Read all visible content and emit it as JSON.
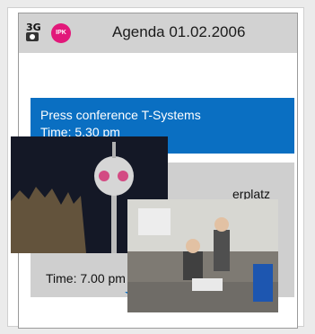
{
  "header": {
    "title": "Agenda 01.02.2006",
    "icons": [
      "3g-icon",
      "ipk-logo"
    ],
    "icon_text": {
      "g3": "3G",
      "ipk": "IPK"
    }
  },
  "events": [
    {
      "line1": "Press conference T-Systems",
      "line2": "Time: 5.30 pm"
    },
    {
      "line1": "erplatz",
      "line2": "Time: 7.00 pm"
    }
  ],
  "photos": [
    "tv-tower-night-photo",
    "meeting-room-photo"
  ],
  "colors": {
    "blue": "#0a6fc2",
    "grey": "#cfcfcf",
    "ipk_pink": "#e2187a"
  }
}
